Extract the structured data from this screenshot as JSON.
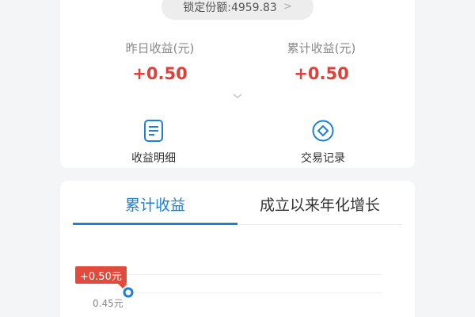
{
  "locked_shares": {
    "label": "锁定份额:4959.83"
  },
  "metrics": [
    {
      "label": "昨日收益(元)",
      "value": "+0.50"
    },
    {
      "label": "累计收益(元)",
      "value": "+0.50"
    }
  ],
  "actions": [
    {
      "label": "收益明细",
      "icon": "document-icon"
    },
    {
      "label": "交易记录",
      "icon": "diamond-coin-icon"
    }
  ],
  "tabs": [
    {
      "label": "累计收益",
      "active": true
    },
    {
      "label": "成立以来年化增长",
      "active": false
    }
  ],
  "colors": {
    "accent": "#1e7fd6",
    "positive": "#e0403a",
    "tooltip": "#e24a3b"
  },
  "chart_data": {
    "type": "line",
    "series": [
      {
        "x": [
          0
        ],
        "values": [
          0.5
        ]
      }
    ],
    "tooltip_label": "+0.50元",
    "yticks": [
      "0.45元"
    ],
    "ylim_min_label": "0.45元"
  }
}
